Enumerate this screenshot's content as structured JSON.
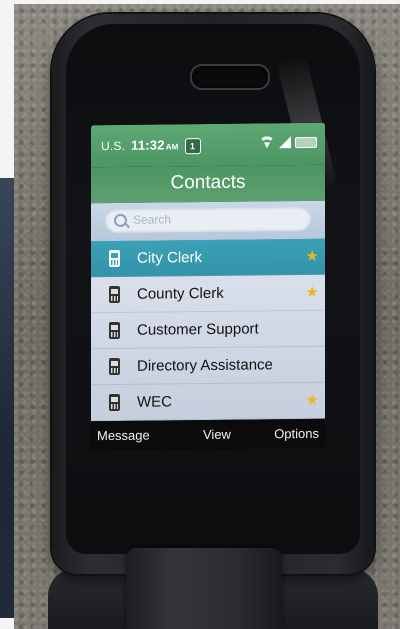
{
  "status_bar": {
    "carrier": "U.S.",
    "time": "11:32",
    "ampm": "AM",
    "notification_count": "1"
  },
  "header": {
    "title": "Contacts"
  },
  "search": {
    "placeholder": "Search"
  },
  "contacts": [
    {
      "name": "City Clerk",
      "favorite": true,
      "selected": true
    },
    {
      "name": "County Clerk",
      "favorite": true,
      "selected": false
    },
    {
      "name": "Customer Support",
      "favorite": false,
      "selected": false
    },
    {
      "name": "Directory Assistance",
      "favorite": false,
      "selected": false
    },
    {
      "name": "WEC",
      "favorite": true,
      "selected": false
    }
  ],
  "softkeys": {
    "left": "Message",
    "center": "View",
    "right": "Options"
  },
  "colors": {
    "header_green": "#4b9663",
    "selection": "#3aa1b7",
    "star": "#f1b51c"
  },
  "icons": {
    "row": "phone-icon",
    "favorite": "star-icon",
    "search": "search-icon"
  }
}
